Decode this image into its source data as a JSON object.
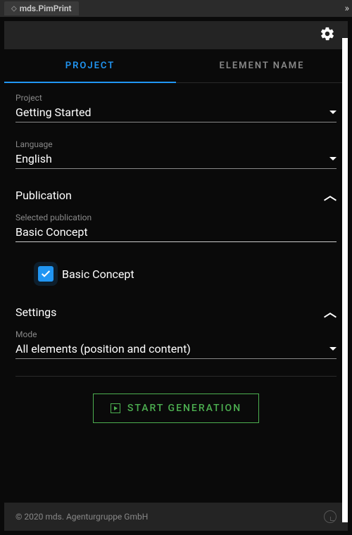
{
  "window": {
    "title": "mds.PimPrint",
    "more": "»"
  },
  "tabs": {
    "project": "PROJECT",
    "element": "ELEMENT NAME"
  },
  "project_field": {
    "label": "Project",
    "value": "Getting Started"
  },
  "language_field": {
    "label": "Language",
    "value": "English"
  },
  "publication_section": {
    "title": "Publication",
    "selected_label": "Selected publication",
    "selected_value": "Basic Concept",
    "items": [
      {
        "label": "Basic Concept",
        "checked": true
      }
    ]
  },
  "settings_section": {
    "title": "Settings",
    "mode_label": "Mode",
    "mode_value": "All elements (position and content)"
  },
  "start_button": "START GENERATION",
  "footer": {
    "copyright": "© 2020 mds. Agenturgruppe GmbH"
  },
  "colors": {
    "accent_blue": "#2196f3",
    "accent_green": "#4caf50",
    "bg_dark": "#0a0a0a",
    "bg_panel": "#242424"
  }
}
